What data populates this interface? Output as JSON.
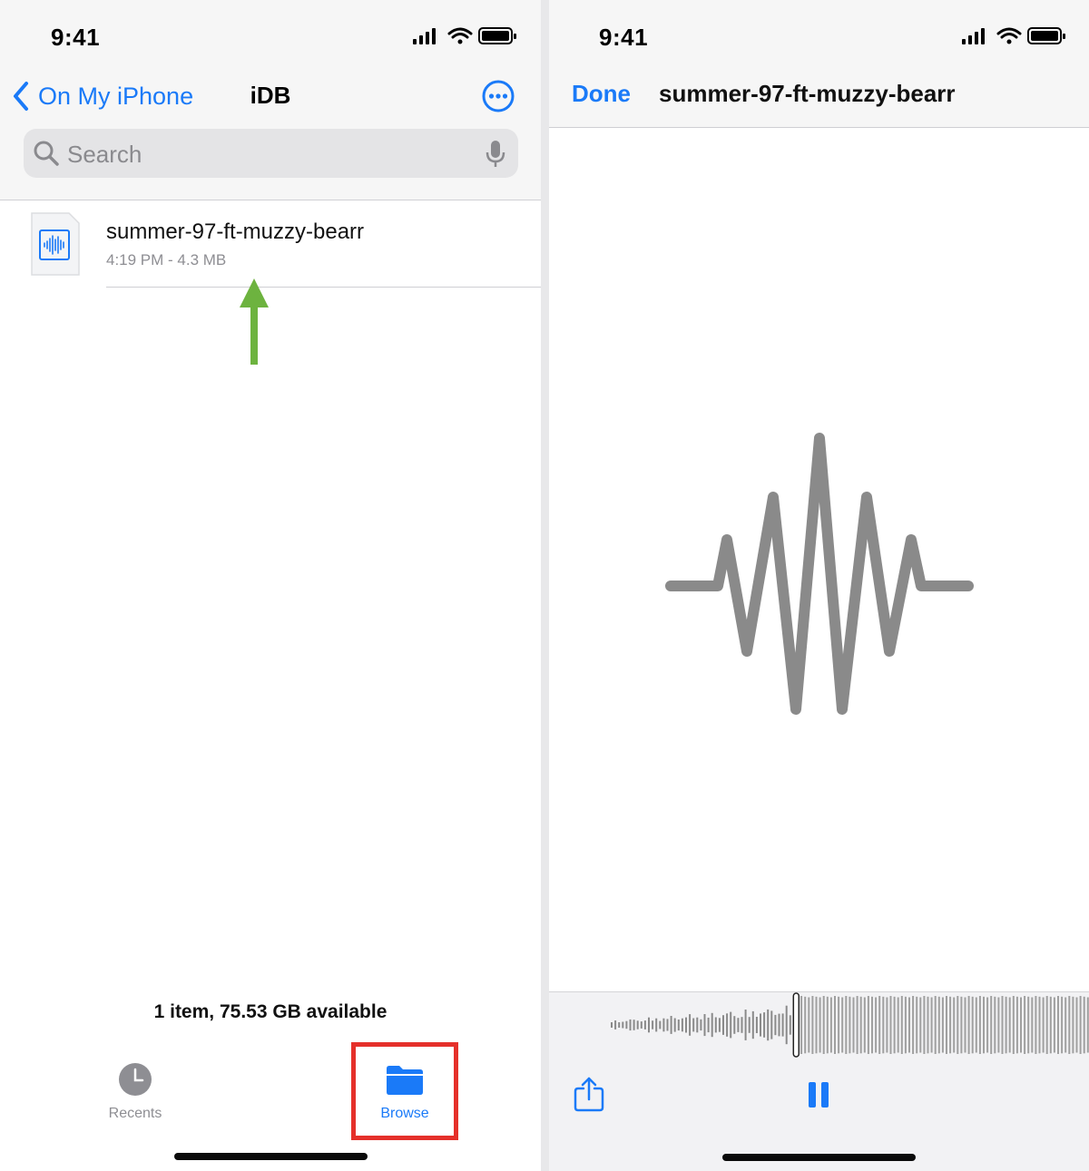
{
  "status_bar": {
    "time": "9:41"
  },
  "files_app": {
    "back_label": "On My iPhone",
    "folder_title": "iDB",
    "search": {
      "placeholder": "Search"
    },
    "files": [
      {
        "name": "summer-97-ft-muzzy-bearr",
        "meta": "4:19 PM - 4.3 MB"
      }
    ],
    "storage_info": "1 item, 75.53 GB available",
    "tabs": [
      {
        "label": "Recents",
        "selected": false
      },
      {
        "label": "Browse",
        "selected": true
      }
    ]
  },
  "preview": {
    "done_label": "Done",
    "title": "summer-97-ft-muzzy-bearr",
    "playback_position": 0.39
  },
  "colors": {
    "accent": "#1a7af8",
    "annotation_arrow": "#6db33f",
    "annotation_box": "#e5302a",
    "waveform": "#8a8a8a"
  }
}
